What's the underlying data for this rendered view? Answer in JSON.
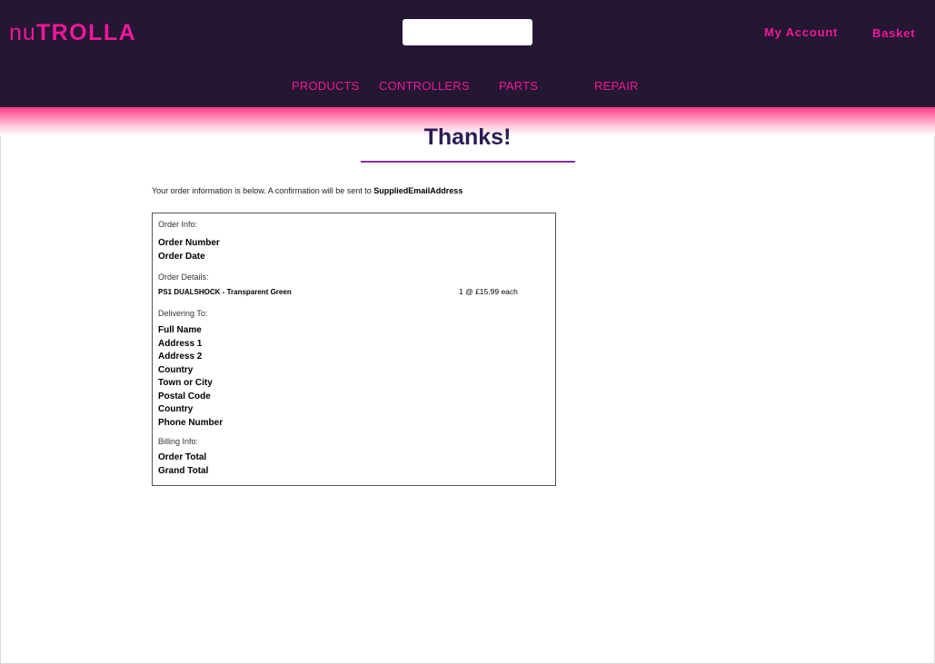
{
  "header": {
    "logo_light": "nu",
    "logo_bold": "TROLLA",
    "search": {
      "value": "",
      "placeholder": ""
    },
    "my_account_label": "My Account",
    "basket_label": "Basket",
    "nav": [
      "PRODUCTS",
      "CONTROLLERS",
      "PARTS",
      "REPAIR"
    ]
  },
  "main": {
    "title": "Thanks!",
    "intro_text": "Your order information is below. A confirmation will be sent to ",
    "email_placeholder": "SuppliedEmailAddress",
    "order_info_label": "Order Info:",
    "order_info_fields": [
      "Order Number",
      "Order Date"
    ],
    "order_details_label": "Order Details:",
    "item": {
      "name": "PS1 DUALSHOCK - Transparent Green",
      "quantity_price": "1 @ £15.99 each"
    },
    "delivering_label": "Delivering To:",
    "delivery_fields": [
      "Full Name",
      "Address 1",
      "Address 2",
      "Country",
      "Town or City",
      "Postal Code",
      "Country",
      "Phone Number"
    ],
    "billing_label": "Billing Info:",
    "billing_fields": [
      "Order Total",
      "Grand Total"
    ]
  },
  "colors": {
    "header_bg": "#241732",
    "accent_pink": "#f0179a",
    "title_color": "#2a1d55",
    "rule_purple": "#8a2aa3"
  }
}
